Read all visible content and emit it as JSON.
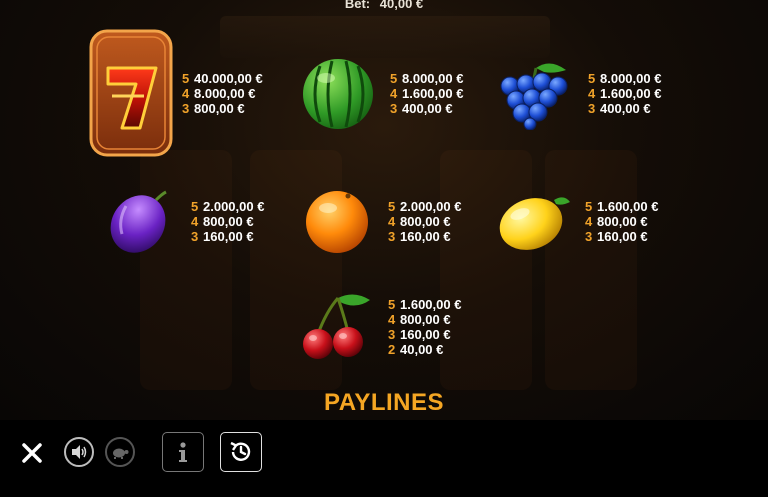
{
  "header": {
    "bet_label": "Bet:",
    "bet_value": "40,00 €"
  },
  "symbols": [
    {
      "name": "seven",
      "icon": "seven-icon",
      "pays": [
        {
          "count": "5",
          "amount": "40.000,00 €"
        },
        {
          "count": "4",
          "amount": "8.000,00 €"
        },
        {
          "count": "3",
          "amount": "800,00 €"
        }
      ]
    },
    {
      "name": "watermelon",
      "icon": "watermelon-icon",
      "pays": [
        {
          "count": "5",
          "amount": "8.000,00 €"
        },
        {
          "count": "4",
          "amount": "1.600,00 €"
        },
        {
          "count": "3",
          "amount": "400,00 €"
        }
      ]
    },
    {
      "name": "grapes",
      "icon": "grapes-icon",
      "pays": [
        {
          "count": "5",
          "amount": "8.000,00 €"
        },
        {
          "count": "4",
          "amount": "1.600,00 €"
        },
        {
          "count": "3",
          "amount": "400,00 €"
        }
      ]
    },
    {
      "name": "plum",
      "icon": "plum-icon",
      "pays": [
        {
          "count": "5",
          "amount": "2.000,00 €"
        },
        {
          "count": "4",
          "amount": "800,00 €"
        },
        {
          "count": "3",
          "amount": "160,00 €"
        }
      ]
    },
    {
      "name": "orange",
      "icon": "orange-icon",
      "pays": [
        {
          "count": "5",
          "amount": "2.000,00 €"
        },
        {
          "count": "4",
          "amount": "800,00 €"
        },
        {
          "count": "3",
          "amount": "160,00 €"
        }
      ]
    },
    {
      "name": "lemon",
      "icon": "lemon-icon",
      "pays": [
        {
          "count": "5",
          "amount": "1.600,00 €"
        },
        {
          "count": "4",
          "amount": "800,00 €"
        },
        {
          "count": "3",
          "amount": "160,00 €"
        }
      ]
    },
    {
      "name": "cherries",
      "icon": "cherries-icon",
      "pays": [
        {
          "count": "5",
          "amount": "1.600,00 €"
        },
        {
          "count": "4",
          "amount": "800,00 €"
        },
        {
          "count": "3",
          "amount": "160,00 €"
        },
        {
          "count": "2",
          "amount": "40,00 €"
        }
      ]
    }
  ],
  "sections": {
    "paylines_title": "PAYLINES"
  },
  "toolbar": {
    "close_icon": "close-icon",
    "sound_icon": "speaker-icon",
    "turbo_icon": "turtle-icon",
    "info_icon": "info-icon",
    "history_icon": "history-icon"
  }
}
